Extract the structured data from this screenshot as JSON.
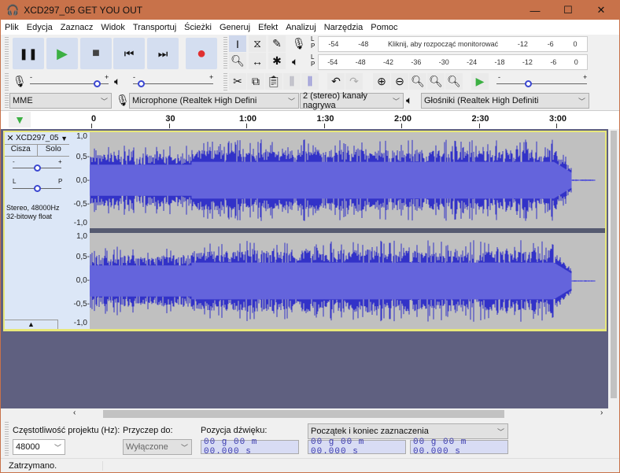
{
  "window": {
    "title": "XCD297_05 GET YOU OUT",
    "minimize": "—",
    "maximize": "☐",
    "close": "✕"
  },
  "menu": [
    "Plik",
    "Edycja",
    "Zaznacz",
    "Widok",
    "Transportuj",
    "Ścieżki",
    "Generuj",
    "Efekt",
    "Analizuj",
    "Narzędzia",
    "Pomoc"
  ],
  "transport": {
    "pause": "❚❚",
    "play": "▶",
    "stop": "■",
    "skip_start": "⏮",
    "skip_end": "⏭",
    "record": "●"
  },
  "meters": {
    "record_scale": [
      "-54",
      "-48",
      "Kliknij, aby rozpocząć monitorować",
      "-12",
      "-6",
      "0"
    ],
    "play_scale": [
      "-54",
      "-48",
      "-42",
      "-36",
      "-30",
      "-24",
      "-18",
      "-12",
      "-6",
      "0"
    ],
    "channel_l": "L",
    "channel_p": "P"
  },
  "sliders": {
    "minus": "-",
    "plus": "+",
    "record_volume": 0.85,
    "play_volume": 0.1,
    "play_speed": 0.35
  },
  "devices": {
    "host": "MME",
    "input": "Microphone (Realtek High Defini",
    "channels": "2 (stereo) kanały nagrywa",
    "output": "Głośniki (Realtek High Definiti"
  },
  "timeline": {
    "ticks": [
      "0",
      "30",
      "1:00",
      "1:30",
      "2:00",
      "2:30",
      "3:00"
    ]
  },
  "track": {
    "name": "XCD297_05",
    "mute": "Cisza",
    "solo": "Solo",
    "gain_minus": "-",
    "gain_plus": "+",
    "pan_l": "L",
    "pan_p": "P",
    "info1": "Stereo, 48000Hz",
    "info2": "32-bitowy float",
    "collapse": "▲",
    "scale": [
      "1,0",
      "0,5-",
      "0,0-",
      "-0,5-",
      "-1,0"
    ]
  },
  "colors": {
    "wave": "#3232c8",
    "rms": "#6464dc",
    "wave_bg": "#c0c0c0",
    "empty": "#5f6080",
    "accent": "#c8724a"
  },
  "selection_bar": {
    "rate_label": "Częstotliwość projektu (Hz):",
    "rate_value": "48000",
    "snap_label": "Przyczep do:",
    "snap_value": "Wyłączone",
    "pos_label": "Pozycja dźwięku:",
    "sel_mode": "Początek i koniec zaznaczenia",
    "pos_value": "00 g 00 m 00.000 s",
    "sel_start": "00 g 00 m 00.000 s",
    "sel_end": "00 g 00 m 00.000 s"
  },
  "status": "Zatrzymano."
}
